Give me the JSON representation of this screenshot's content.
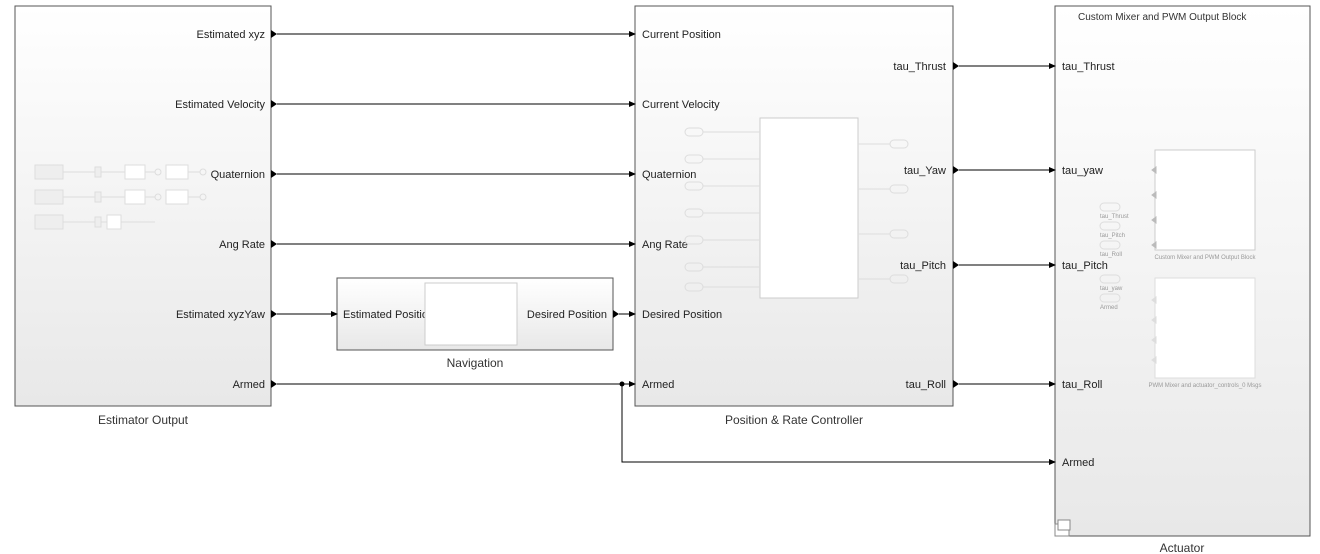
{
  "blocks": {
    "estimator": {
      "label": "Estimator Output",
      "outputs": [
        "Estimated xyz",
        "Estimated Velocity",
        "Quaternion",
        "Ang Rate",
        "Estimated xyzYaw",
        "Armed"
      ]
    },
    "navigation": {
      "label": "Navigation",
      "inputs": [
        "Estimated Position & Yaw"
      ],
      "outputs": [
        "Desired Position"
      ]
    },
    "controller": {
      "label": "Position & Rate Controller",
      "inputs": [
        "Current Position",
        "Current Velocity",
        "Quaternion",
        "Ang Rate",
        "Desired Position",
        "Armed"
      ],
      "outputs": [
        "tau_Thrust",
        "tau_Yaw",
        "tau_Pitch",
        "tau_Roll"
      ]
    },
    "actuator": {
      "label": "Actuator",
      "title": "Custom Mixer and PWM Output Block",
      "inputs": [
        "tau_Thrust",
        "tau_yaw",
        "tau_Pitch",
        "tau_Roll",
        "Armed"
      ],
      "innerPorts": [
        "tau_Thrust",
        "tau_Pitch",
        "tau_Roll",
        "tau_yaw",
        "Armed"
      ],
      "innerCaption1": "Custom Mixer and PWM Output Block",
      "innerCaption2": "PWM Mixer and actuator_controls_0 Msgs"
    }
  }
}
